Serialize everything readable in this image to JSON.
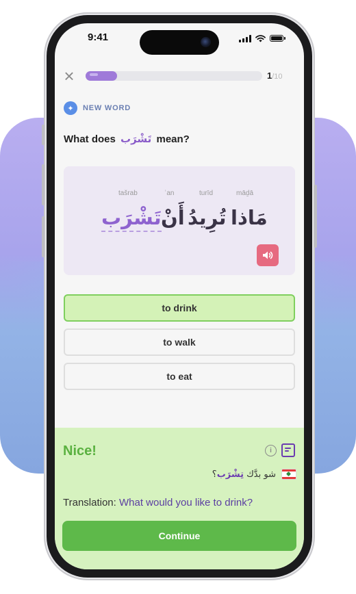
{
  "status_bar": {
    "time": "9:41"
  },
  "lesson": {
    "progress": {
      "current": "1",
      "total": "/10",
      "fraction": 0.1
    },
    "section_label": "NEW WORD",
    "question_prefix": "What does",
    "question_word": "تَشْرَب",
    "question_suffix": "mean?"
  },
  "sentence": {
    "words": [
      {
        "arabic": "مَاذا",
        "translit": "māḏā",
        "highlight": false
      },
      {
        "arabic": "تُرِيدُ",
        "translit": "turīd",
        "highlight": false
      },
      {
        "arabic": "أَنْ",
        "translit": "ʾan",
        "highlight": false
      },
      {
        "arabic": "تَشْرَب",
        "translit": "tašrab",
        "highlight": true
      }
    ]
  },
  "options": [
    {
      "label": "to drink",
      "state": "correct"
    },
    {
      "label": "to walk",
      "state": "default"
    },
    {
      "label": "to eat",
      "state": "default"
    }
  ],
  "feedback": {
    "title": "Nice!",
    "dialect_example_prefix": "شو بدَّك",
    "dialect_example_word": "تِشْرَب",
    "dialect_example_suffix": "؟",
    "translation_label": "Translation:",
    "translation_text": "What would you like to drink?",
    "continue_label": "Continue"
  },
  "colors": {
    "accent_purple": "#8e63cf",
    "correct_green": "#7fcf5e",
    "continue_green": "#5eb94a",
    "speaker_red": "#e66a80"
  },
  "icons": [
    "close-icon",
    "sparkle-icon",
    "speaker-icon",
    "info-icon",
    "notes-icon",
    "lebanon-flag-icon",
    "signal-icon",
    "wifi-icon",
    "battery-icon"
  ]
}
